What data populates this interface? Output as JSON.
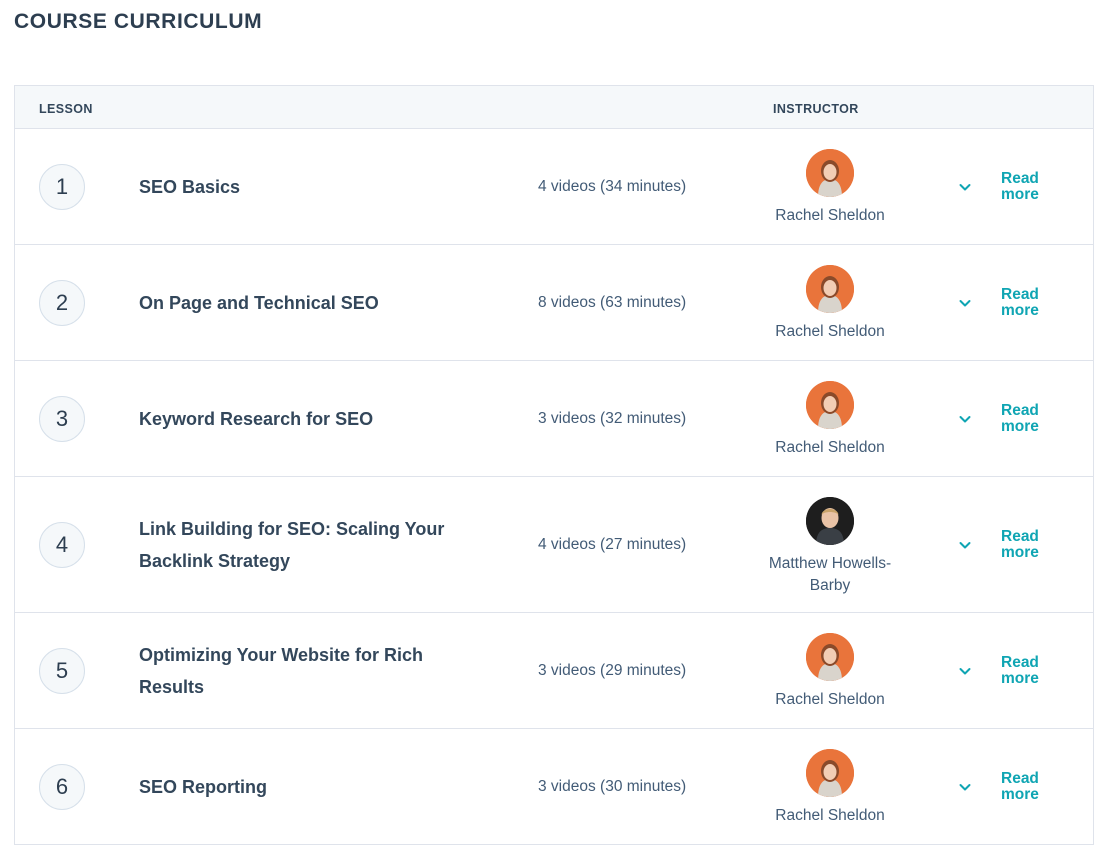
{
  "page_title": "COURSE CURRICULUM",
  "table": {
    "headers": {
      "lesson": "LESSON",
      "instructor": "INSTRUCTOR"
    },
    "rows": [
      {
        "number": "1",
        "title": "SEO Basics",
        "videos": "4 videos (34 minutes)",
        "instructor": "Rachel Sheldon",
        "avatar": "rachel-avatar",
        "read_more": "Read more"
      },
      {
        "number": "2",
        "title": "On Page and Technical SEO",
        "videos": "8 videos (63 minutes)",
        "instructor": "Rachel Sheldon",
        "avatar": "rachel-avatar",
        "read_more": "Read more"
      },
      {
        "number": "3",
        "title": "Keyword Research for SEO",
        "videos": "3 videos (32 minutes)",
        "instructor": "Rachel Sheldon",
        "avatar": "rachel-avatar",
        "read_more": "Read more"
      },
      {
        "number": "4",
        "title": "Link Building for SEO: Scaling Your Backlink Strategy",
        "videos": "4 videos (27 minutes)",
        "instructor": "Matthew Howells-Barby",
        "avatar": "matthew-avatar",
        "read_more": "Read more"
      },
      {
        "number": "5",
        "title": "Optimizing Your Website for Rich Results",
        "videos": "3 videos (29 minutes)",
        "instructor": "Rachel Sheldon",
        "avatar": "rachel-avatar",
        "read_more": "Read more"
      },
      {
        "number": "6",
        "title": "SEO Reporting",
        "videos": "3 videos (30 minutes)",
        "instructor": "Rachel Sheldon",
        "avatar": "rachel-avatar",
        "read_more": "Read more"
      }
    ]
  },
  "colors": {
    "accent": "#0fa5b3",
    "text": "#33475b",
    "header_bg": "#f5f8fa",
    "border": "#dfe3eb"
  },
  "icons": {
    "expand": "chevron-down-icon"
  }
}
